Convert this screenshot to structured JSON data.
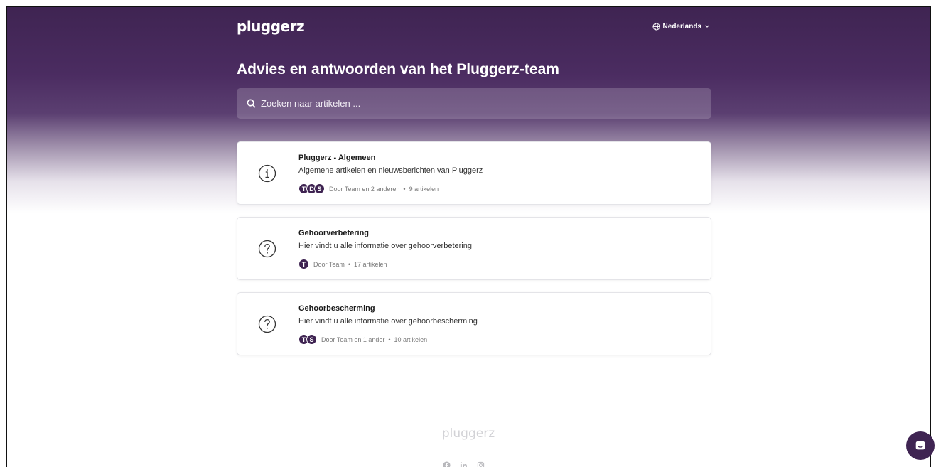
{
  "header": {
    "logo": "pluggerz",
    "language": "Nederlands"
  },
  "hero": {
    "title": "Advies en antwoorden van het Pluggerz-team",
    "search_placeholder": "Zoeken naar artikelen ..."
  },
  "collections": [
    {
      "icon": "info-icon",
      "title": "Pluggerz - Algemeen",
      "description": "Algemene artikelen en nieuwsberichten van Pluggerz",
      "avatars": [
        "T",
        "D",
        "S"
      ],
      "authors": "Door Team en 2 anderen",
      "articles": "9 artikelen"
    },
    {
      "icon": "question-icon",
      "title": "Gehoorverbetering",
      "description": "Hier vindt u alle informatie over gehoorverbetering",
      "avatars": [
        "T"
      ],
      "authors": "Door Team",
      "articles": "17 artikelen"
    },
    {
      "icon": "question-icon",
      "title": "Gehoorbescherming",
      "description": "Hier vindt u alle informatie over gehoorbescherming",
      "avatars": [
        "T",
        "S"
      ],
      "authors": "Door Team en 1 ander",
      "articles": "10 artikelen"
    }
  ],
  "footer": {
    "logo": "pluggerz",
    "social_icons": [
      "facebook-icon",
      "linkedin-icon",
      "instagram-icon"
    ]
  },
  "colors": {
    "brand": "#3f2452",
    "separator": "•"
  }
}
